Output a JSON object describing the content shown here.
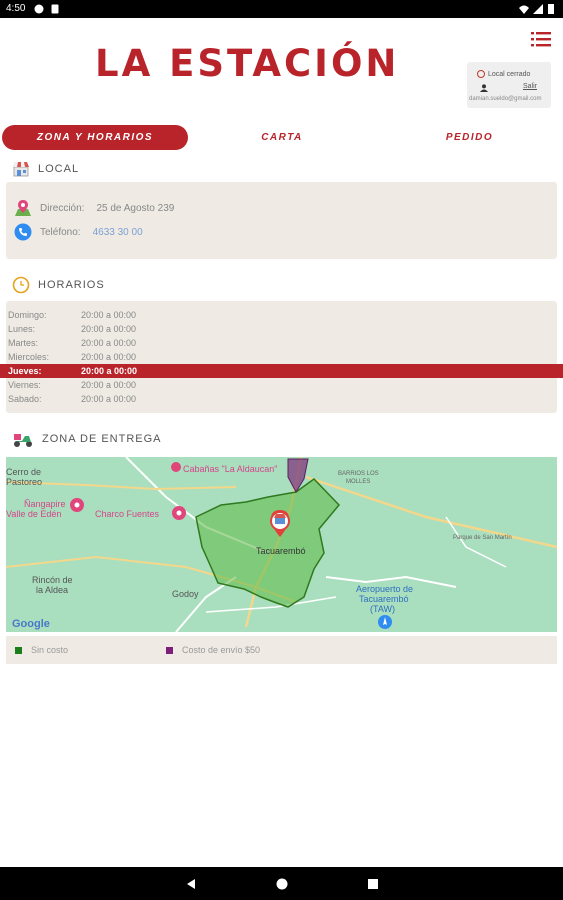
{
  "status_bar": {
    "time": "4:50"
  },
  "header": {
    "brand": "LA ESTACIÓN",
    "status_label": "Local cerrado",
    "logout_label": "Salir",
    "user_email": "damian.sueldo@gmail.com"
  },
  "tabs": [
    {
      "label": "ZONA Y HORARIOS",
      "active": true
    },
    {
      "label": "CARTA",
      "active": false
    },
    {
      "label": "PEDIDO",
      "active": false
    }
  ],
  "local": {
    "title": "LOCAL",
    "address_label": "Dirección:",
    "address_value": "25 de Agosto 239",
    "phone_label": "Teléfono:",
    "phone_value": "4633 30 00"
  },
  "horarios": {
    "title": "HORARIOS",
    "rows": [
      {
        "day": "Domingo:",
        "time": "20:00 a 00:00"
      },
      {
        "day": "Lunes:",
        "time": "20:00 a 00:00"
      },
      {
        "day": "Martes:",
        "time": "20:00 a 00:00"
      },
      {
        "day": "Miercoles:",
        "time": "20:00 a 00:00"
      },
      {
        "day": "Jueves:",
        "time": "20:00 a 00:00",
        "today": true
      },
      {
        "day": "Viernes:",
        "time": "20:00 a 00:00"
      },
      {
        "day": "Sabado:",
        "time": "20:00 a 00:00"
      }
    ]
  },
  "zona": {
    "title": "ZONA DE ENTREGA",
    "map_labels": {
      "cabanas": "Cabañas \"La Aldaucan\"",
      "cerro1": "Cerro de",
      "cerro2": "Pastoreo",
      "nangapire1": "Ñangapire",
      "nangapire2": "Valle de Edén",
      "charco": "Charco Fuentes",
      "tacuarembo": "Tacuarembó",
      "rincon1": "Rincón de",
      "rincon2": "la Aldea",
      "godoy": "Godoy",
      "aeropuerto1": "Aeropuerto de",
      "aeropuerto2": "Tacuarembó",
      "aeropuerto3": "(TAW)",
      "barrios1": "BARRIOS LOS",
      "barrios2": "MOLLES",
      "ruta": "Parque de San Martín",
      "google": "Google"
    },
    "legend": [
      {
        "label": "Sin costo",
        "color": "#1a7f1a"
      },
      {
        "label": "Costo de envío $50",
        "color": "#7b1f7a"
      }
    ]
  },
  "colors": {
    "brand_red": "#b8242a",
    "panel_bg": "#efebe4"
  }
}
